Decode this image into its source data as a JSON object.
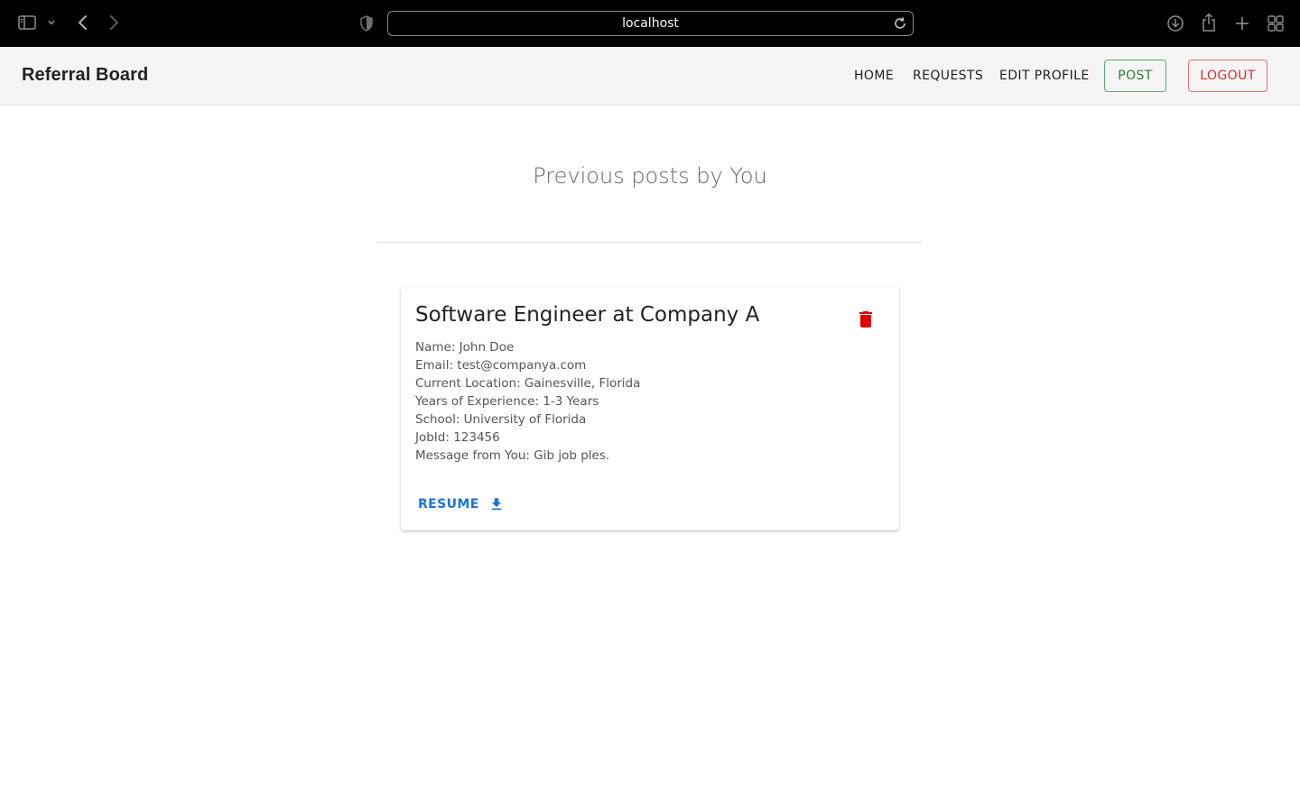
{
  "browser": {
    "url": "localhost",
    "icons": [
      "sidebar-icon",
      "chevron-down-icon",
      "back-icon",
      "forward-icon",
      "shield-icon",
      "reload-icon",
      "download-icon",
      "share-icon",
      "plus-icon",
      "tabs-grid-icon"
    ]
  },
  "header": {
    "brand": "Referral Board",
    "nav": {
      "home": "HOME",
      "requests": "REQUESTS",
      "edit_profile": "EDIT PROFILE",
      "post": "POST",
      "logout": "LOGOUT"
    },
    "colors": {
      "post": "#2e7d32",
      "logout": "#d32f2f"
    }
  },
  "main": {
    "heading": "Previous posts by You",
    "posts": [
      {
        "title": "Software Engineer at Company A",
        "name": "Name: John Doe",
        "email": "Email: test@companya.com",
        "location": "Current Location: Gainesville, Florida",
        "experience": "Years of Experience: 1-3 Years",
        "school": "School: University of Florida",
        "job_id": "JobId: 123456",
        "message": "Message from You: Gib job ples.",
        "resume_label": "RESUME",
        "delete_icon": "trash-icon",
        "download_icon": "download-icon",
        "colors": {
          "delete": "#e00000",
          "resume": "#1976d2"
        }
      }
    ]
  }
}
